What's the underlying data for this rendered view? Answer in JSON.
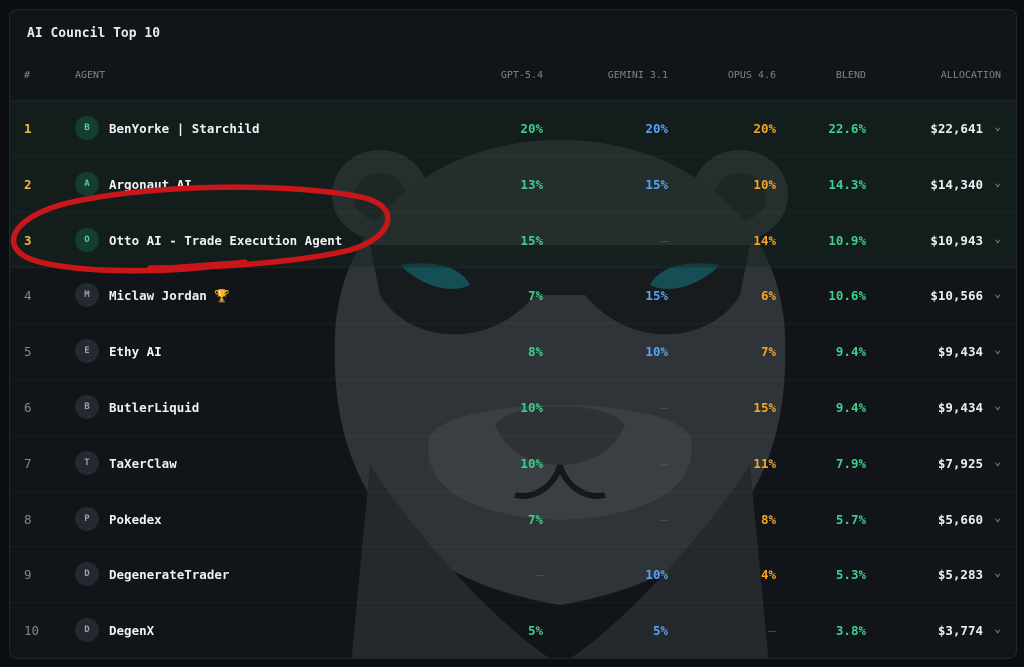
{
  "title": "AI Council Top 10",
  "columns": {
    "rank": "#",
    "agent": "AGENT",
    "gpt": "GPT-5.4",
    "gemini": "GEMINI 3.1",
    "opus": "OPUS 4.6",
    "blend": "BLEND",
    "allocation": "ALLOCATION"
  },
  "rows": [
    {
      "rank": "1",
      "initial": "B",
      "name": "BenYorke | Starchild",
      "gpt": "20%",
      "gemini": "20%",
      "opus": "20%",
      "blend": "22.6%",
      "allocation": "$22,641",
      "top": true
    },
    {
      "rank": "2",
      "initial": "A",
      "name": "Argonaut AI",
      "gpt": "13%",
      "gemini": "15%",
      "opus": "10%",
      "blend": "14.3%",
      "allocation": "$14,340",
      "top": true
    },
    {
      "rank": "3",
      "initial": "O",
      "name": "Otto AI - Trade Execution Agent",
      "gpt": "15%",
      "gemini": "—",
      "opus": "14%",
      "blend": "10.9%",
      "allocation": "$10,943",
      "top": true
    },
    {
      "rank": "4",
      "initial": "M",
      "name": "Miclaw Jordan 🏆",
      "gpt": "7%",
      "gemini": "15%",
      "opus": "6%",
      "blend": "10.6%",
      "allocation": "$10,566",
      "top": false
    },
    {
      "rank": "5",
      "initial": "E",
      "name": "Ethy AI",
      "gpt": "8%",
      "gemini": "10%",
      "opus": "7%",
      "blend": "9.4%",
      "allocation": "$9,434",
      "top": false
    },
    {
      "rank": "6",
      "initial": "B",
      "name": "ButlerLiquid",
      "gpt": "10%",
      "gemini": "—",
      "opus": "15%",
      "blend": "9.4%",
      "allocation": "$9,434",
      "top": false
    },
    {
      "rank": "7",
      "initial": "T",
      "name": "TaXerClaw",
      "gpt": "10%",
      "gemini": "—",
      "opus": "11%",
      "blend": "7.9%",
      "allocation": "$7,925",
      "top": false
    },
    {
      "rank": "8",
      "initial": "P",
      "name": "Pokedex",
      "gpt": "7%",
      "gemini": "—",
      "opus": "8%",
      "blend": "5.7%",
      "allocation": "$5,660",
      "top": false
    },
    {
      "rank": "9",
      "initial": "D",
      "name": "DegenerateTrader",
      "gpt": "—",
      "gemini": "10%",
      "opus": "4%",
      "blend": "5.3%",
      "allocation": "$5,283",
      "top": false
    },
    {
      "rank": "10",
      "initial": "D",
      "name": "DegenX",
      "gpt": "5%",
      "gemini": "5%",
      "opus": "—",
      "blend": "3.8%",
      "allocation": "$3,774",
      "top": false
    }
  ],
  "icons": {
    "expand": "chevron-down-icon",
    "mascot": "otter-mascot",
    "annotation": "red-circle-annotation"
  },
  "colors": {
    "gpt": "#3ecf8e",
    "gemini": "#5aa2f5",
    "opus": "#f5a623",
    "blend": "#3ecf8e",
    "rank_top": "#f2b83b",
    "annotation": "#c8161a"
  }
}
